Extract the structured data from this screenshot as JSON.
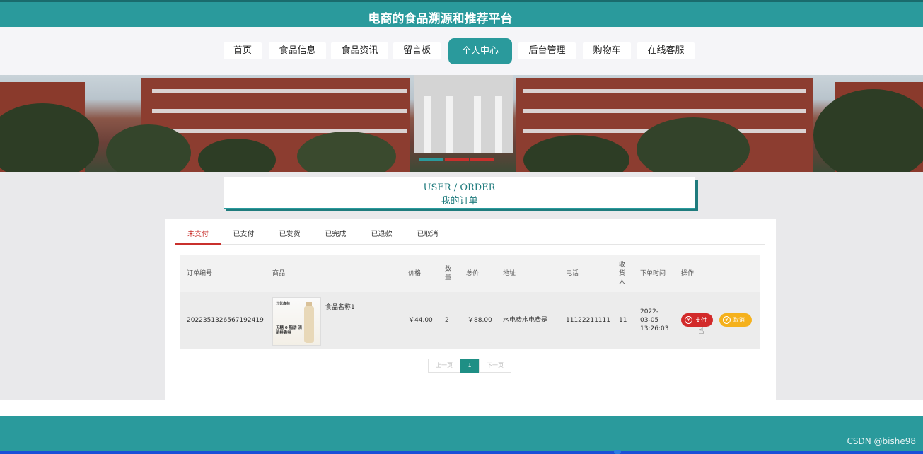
{
  "header": {
    "title": "电商的食品溯源和推荐平台"
  },
  "nav": {
    "items": [
      {
        "label": "首页"
      },
      {
        "label": "食品信息"
      },
      {
        "label": "食品资讯"
      },
      {
        "label": "留言板"
      },
      {
        "label": "个人中心"
      },
      {
        "label": "后台管理"
      },
      {
        "label": "购物车"
      },
      {
        "label": "在线客服"
      }
    ],
    "active_index": 4
  },
  "banner": {
    "slide_count": 3,
    "active_slide": 1
  },
  "section": {
    "title_en": "USER / ORDER",
    "title_cn": "我的订单"
  },
  "tabs": [
    {
      "label": "未支付"
    },
    {
      "label": "已支付"
    },
    {
      "label": "已发货"
    },
    {
      "label": "已完成"
    },
    {
      "label": "已退款"
    },
    {
      "label": "已取消"
    }
  ],
  "active_tab": 0,
  "table": {
    "headers": {
      "order_no": "订单编号",
      "product": "商品",
      "price": "价格",
      "qty": "数量",
      "total": "总价",
      "address": "地址",
      "phone": "电话",
      "receiver": "收货人",
      "order_time": "下单时间",
      "actions": "操作"
    },
    "rows": [
      {
        "order_no": "20223513265671924​19",
        "product_image_text_top": "元気森林",
        "product_image_text_bottom": "无糖 0 脂肪 清新桂香味",
        "product_name": "食品名称1",
        "price": "￥44.00",
        "qty": "2",
        "total": "￥88.00",
        "address": "水电费水电费是",
        "phone": "11122211111",
        "receiver": "11",
        "order_time": "2022-03-05 13:26:03",
        "pay_label": "支付",
        "cancel_label": "取消"
      }
    ]
  },
  "pager": {
    "prev": "上一页",
    "current": "1",
    "next": "下一页"
  },
  "watermark": "CSDN @bishe98",
  "colors": {
    "primary": "#2a9a9c",
    "active_tab": "#c9302c",
    "pay": "#d22a2a",
    "cancel": "#f5b11c"
  }
}
